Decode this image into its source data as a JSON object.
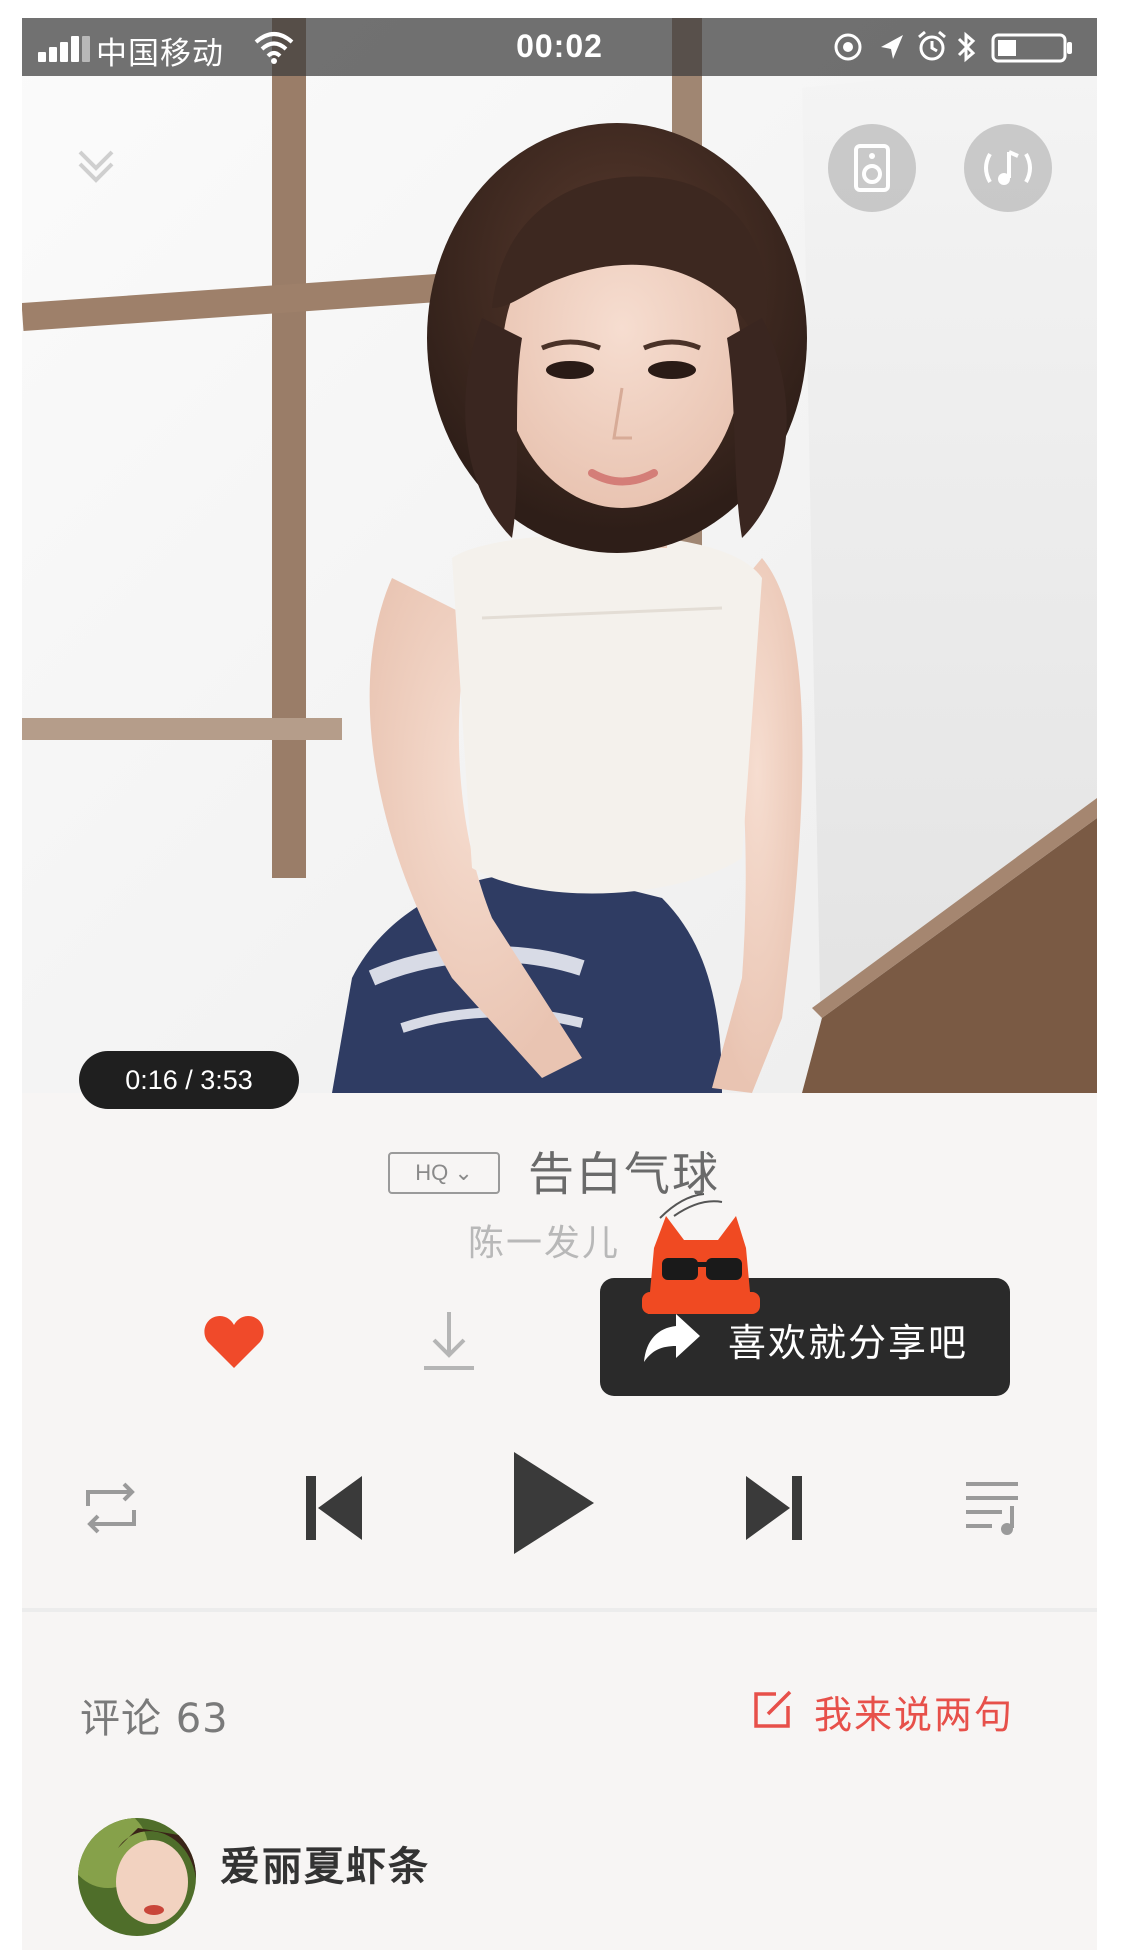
{
  "status_bar": {
    "carrier": "中国移动",
    "time": "00:02",
    "icons": [
      "signal-icon",
      "wifi-icon",
      "location-icon",
      "alarm-icon",
      "bluetooth-icon",
      "battery-icon"
    ]
  },
  "player": {
    "elapsed": "0:16 / 3:53",
    "quality": "HQ ⌄",
    "song_title": "告白气球",
    "artist": "陈一发儿",
    "share_tip": "喜欢就分享吧",
    "liked": true,
    "accent_color": "#f04a2a",
    "header_icons": [
      "collapse-icon",
      "speaker-icon",
      "sound-effect-icon"
    ],
    "controls": [
      "repeat-icon",
      "previous-icon",
      "play-icon",
      "next-icon",
      "playlist-icon"
    ]
  },
  "comments": {
    "label": "评论 63",
    "write_label": "我来说两句",
    "write_color": "#e7504a",
    "first_user": "爱丽夏虾条"
  }
}
